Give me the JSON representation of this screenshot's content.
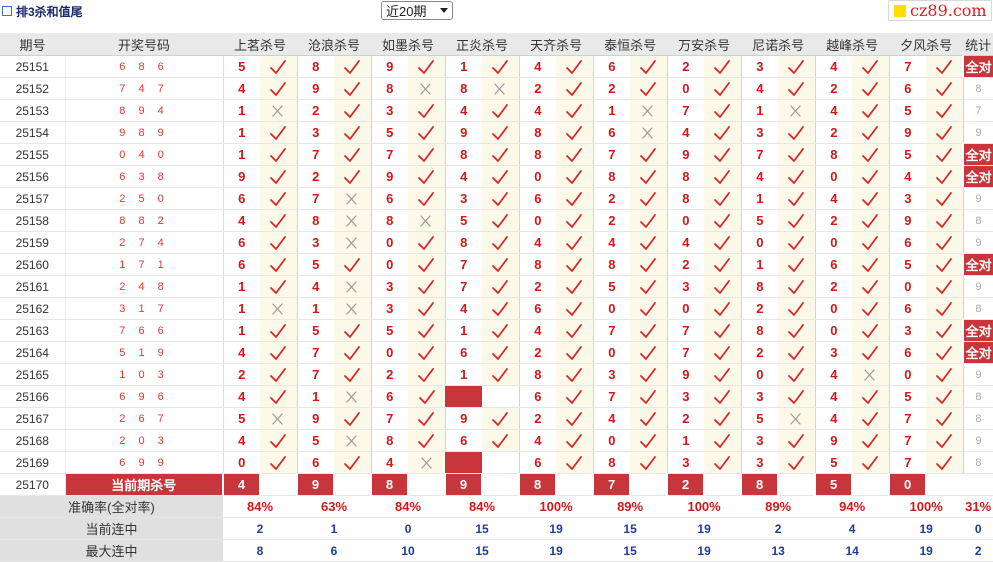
{
  "header": {
    "title": "排3杀和值尾",
    "period_select": "近20期",
    "logo": "cz89.com"
  },
  "columns": {
    "period": "期号",
    "number": "开奖号码",
    "experts": [
      "上茗杀号",
      "沧浪杀号",
      "如墨杀号",
      "正炎杀号",
      "天齐杀号",
      "泰恒杀号",
      "万安杀号",
      "尼诺杀号",
      "越峰杀号",
      "夕风杀号"
    ],
    "stat": "统计"
  },
  "rows": [
    {
      "period": "25151",
      "win": "6 8 6",
      "k": [
        [
          5,
          1
        ],
        [
          8,
          1
        ],
        [
          9,
          1
        ],
        [
          1,
          1
        ],
        [
          4,
          1
        ],
        [
          6,
          1
        ],
        [
          2,
          1
        ],
        [
          3,
          1
        ],
        [
          4,
          1
        ],
        [
          7,
          1
        ]
      ],
      "stat": "全对"
    },
    {
      "period": "25152",
      "win": "7 4 7",
      "k": [
        [
          4,
          1
        ],
        [
          9,
          1
        ],
        [
          8,
          0
        ],
        [
          8,
          0
        ],
        [
          2,
          1
        ],
        [
          2,
          1
        ],
        [
          0,
          1
        ],
        [
          4,
          1
        ],
        [
          2,
          1
        ],
        [
          6,
          1
        ]
      ],
      "stat": "8"
    },
    {
      "period": "25153",
      "win": "8 9 4",
      "k": [
        [
          1,
          0
        ],
        [
          2,
          1
        ],
        [
          3,
          1
        ],
        [
          4,
          1
        ],
        [
          4,
          1
        ],
        [
          1,
          0
        ],
        [
          7,
          1
        ],
        [
          1,
          0
        ],
        [
          4,
          1
        ],
        [
          5,
          1
        ]
      ],
      "stat": "7"
    },
    {
      "period": "25154",
      "win": "9 8 9",
      "k": [
        [
          1,
          1
        ],
        [
          3,
          1
        ],
        [
          5,
          1
        ],
        [
          9,
          1
        ],
        [
          8,
          1
        ],
        [
          6,
          0
        ],
        [
          4,
          1
        ],
        [
          3,
          1
        ],
        [
          2,
          1
        ],
        [
          9,
          1
        ]
      ],
      "stat": "9"
    },
    {
      "period": "25155",
      "win": "0 4 0",
      "k": [
        [
          1,
          1
        ],
        [
          7,
          1
        ],
        [
          7,
          1
        ],
        [
          8,
          1
        ],
        [
          8,
          1
        ],
        [
          7,
          1
        ],
        [
          9,
          1
        ],
        [
          7,
          1
        ],
        [
          8,
          1
        ],
        [
          5,
          1
        ]
      ],
      "stat": "全对"
    },
    {
      "period": "25156",
      "win": "6 3 8",
      "k": [
        [
          9,
          1
        ],
        [
          2,
          1
        ],
        [
          9,
          1
        ],
        [
          4,
          1
        ],
        [
          0,
          1
        ],
        [
          8,
          1
        ],
        [
          8,
          1
        ],
        [
          4,
          1
        ],
        [
          0,
          1
        ],
        [
          4,
          1
        ]
      ],
      "stat": "全对"
    },
    {
      "period": "25157",
      "win": "2 5 0",
      "k": [
        [
          6,
          1
        ],
        [
          7,
          0
        ],
        [
          6,
          1
        ],
        [
          3,
          1
        ],
        [
          6,
          1
        ],
        [
          2,
          1
        ],
        [
          8,
          1
        ],
        [
          1,
          1
        ],
        [
          4,
          1
        ],
        [
          3,
          1
        ]
      ],
      "stat": "9"
    },
    {
      "period": "25158",
      "win": "8 8 2",
      "k": [
        [
          4,
          1
        ],
        [
          8,
          0
        ],
        [
          8,
          0
        ],
        [
          5,
          1
        ],
        [
          0,
          1
        ],
        [
          2,
          1
        ],
        [
          0,
          1
        ],
        [
          5,
          1
        ],
        [
          2,
          1
        ],
        [
          9,
          1
        ]
      ],
      "stat": "8"
    },
    {
      "period": "25159",
      "win": "2 7 4",
      "k": [
        [
          6,
          1
        ],
        [
          3,
          0
        ],
        [
          0,
          1
        ],
        [
          8,
          1
        ],
        [
          4,
          1
        ],
        [
          4,
          1
        ],
        [
          4,
          1
        ],
        [
          0,
          1
        ],
        [
          0,
          1
        ],
        [
          6,
          1
        ]
      ],
      "stat": "9"
    },
    {
      "period": "25160",
      "win": "1 7 1",
      "k": [
        [
          6,
          1
        ],
        [
          5,
          1
        ],
        [
          0,
          1
        ],
        [
          7,
          1
        ],
        [
          8,
          1
        ],
        [
          8,
          1
        ],
        [
          2,
          1
        ],
        [
          1,
          1
        ],
        [
          6,
          1
        ],
        [
          5,
          1
        ]
      ],
      "stat": "全对"
    },
    {
      "period": "25161",
      "win": "2 4 8",
      "k": [
        [
          1,
          1
        ],
        [
          4,
          0
        ],
        [
          3,
          1
        ],
        [
          7,
          1
        ],
        [
          2,
          1
        ],
        [
          5,
          1
        ],
        [
          3,
          1
        ],
        [
          8,
          1
        ],
        [
          2,
          1
        ],
        [
          0,
          1
        ]
      ],
      "stat": "9"
    },
    {
      "period": "25162",
      "win": "3 1 7",
      "k": [
        [
          1,
          0
        ],
        [
          1,
          0
        ],
        [
          3,
          1
        ],
        [
          4,
          1
        ],
        [
          6,
          1
        ],
        [
          0,
          1
        ],
        [
          0,
          1
        ],
        [
          2,
          1
        ],
        [
          0,
          1
        ],
        [
          6,
          1
        ]
      ],
      "stat": "8"
    },
    {
      "period": "25163",
      "win": "7 6 6",
      "k": [
        [
          1,
          1
        ],
        [
          5,
          1
        ],
        [
          5,
          1
        ],
        [
          1,
          1
        ],
        [
          4,
          1
        ],
        [
          7,
          1
        ],
        [
          7,
          1
        ],
        [
          8,
          1
        ],
        [
          0,
          1
        ],
        [
          3,
          1
        ]
      ],
      "stat": "全对"
    },
    {
      "period": "25164",
      "win": "5 1 9",
      "k": [
        [
          4,
          1
        ],
        [
          7,
          1
        ],
        [
          0,
          1
        ],
        [
          6,
          1
        ],
        [
          2,
          1
        ],
        [
          0,
          1
        ],
        [
          7,
          1
        ],
        [
          2,
          1
        ],
        [
          3,
          1
        ],
        [
          6,
          1
        ]
      ],
      "stat": "全对"
    },
    {
      "period": "25165",
      "win": "1 0 3",
      "k": [
        [
          2,
          1
        ],
        [
          7,
          1
        ],
        [
          2,
          1
        ],
        [
          1,
          1
        ],
        [
          8,
          1
        ],
        [
          3,
          1
        ],
        [
          9,
          1
        ],
        [
          0,
          1
        ],
        [
          4,
          0
        ],
        [
          0,
          1
        ]
      ],
      "stat": "9"
    },
    {
      "period": "25166",
      "win": "6 9 6",
      "k": [
        [
          4,
          1
        ],
        [
          1,
          0
        ],
        [
          6,
          1
        ],
        [
          null,
          2
        ],
        [
          6,
          1
        ],
        [
          7,
          1
        ],
        [
          3,
          1
        ],
        [
          3,
          1
        ],
        [
          4,
          1
        ],
        [
          5,
          1
        ]
      ],
      "stat": "8"
    },
    {
      "period": "25167",
      "win": "2 6 7",
      "k": [
        [
          5,
          0
        ],
        [
          9,
          1
        ],
        [
          7,
          1
        ],
        [
          9,
          1
        ],
        [
          2,
          1
        ],
        [
          4,
          1
        ],
        [
          2,
          1
        ],
        [
          5,
          0
        ],
        [
          4,
          1
        ],
        [
          7,
          1
        ]
      ],
      "stat": "8"
    },
    {
      "period": "25168",
      "win": "2 0 3",
      "k": [
        [
          4,
          1
        ],
        [
          5,
          0
        ],
        [
          8,
          1
        ],
        [
          6,
          1
        ],
        [
          4,
          1
        ],
        [
          0,
          1
        ],
        [
          1,
          1
        ],
        [
          3,
          1
        ],
        [
          9,
          1
        ],
        [
          7,
          1
        ]
      ],
      "stat": "9"
    },
    {
      "period": "25169",
      "win": "6 9 9",
      "k": [
        [
          0,
          1
        ],
        [
          6,
          1
        ],
        [
          4,
          0
        ],
        [
          null,
          2
        ],
        [
          6,
          1
        ],
        [
          8,
          1
        ],
        [
          3,
          1
        ],
        [
          3,
          1
        ],
        [
          5,
          1
        ],
        [
          7,
          1
        ]
      ],
      "stat": "8"
    }
  ],
  "current": {
    "period": "25170",
    "label": "当前期杀号",
    "picks": [
      "4",
      "9",
      "8",
      "9",
      "8",
      "7",
      "2",
      "8",
      "5",
      "0"
    ]
  },
  "summary": [
    {
      "label": "准确率(全对率)",
      "values": [
        "84%",
        "63%",
        "84%",
        "84%",
        "100%",
        "89%",
        "100%",
        "89%",
        "94%",
        "100%"
      ],
      "stat": "31%",
      "cls": "sa"
    },
    {
      "label": "当前连中",
      "values": [
        "2",
        "1",
        "0",
        "15",
        "19",
        "15",
        "19",
        "2",
        "4",
        "19"
      ],
      "stat": "0",
      "cls": "sb"
    },
    {
      "label": "最大连中",
      "values": [
        "8",
        "6",
        "10",
        "15",
        "19",
        "15",
        "19",
        "13",
        "14",
        "19"
      ],
      "stat": "2",
      "cls": "sb"
    }
  ],
  "icons": {
    "correct": "check-icon",
    "wrong": "cross-icon"
  },
  "colors": {
    "accent": "#c8353a",
    "number": "#d31818",
    "highlight": "#fdf9e8",
    "blue": "#1f3c9c"
  }
}
